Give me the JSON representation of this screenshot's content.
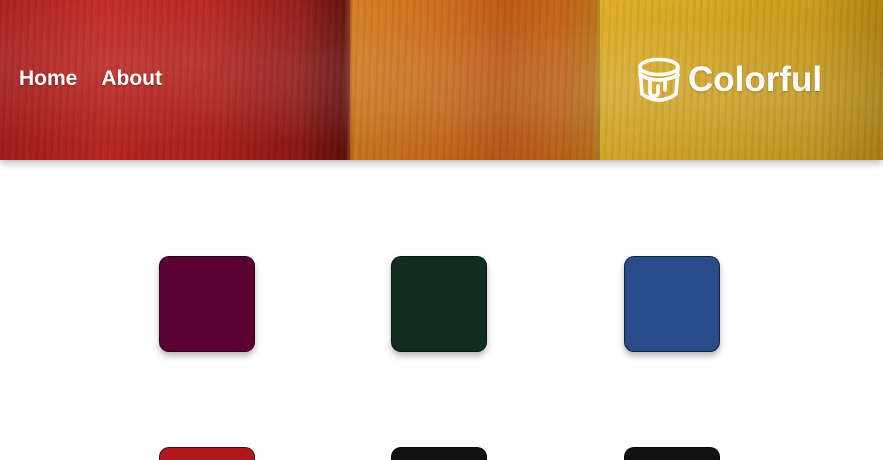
{
  "nav": {
    "home_label": "Home",
    "about_label": "About"
  },
  "brand": {
    "name": "Colorful",
    "icon": "paint-bucket-icon"
  },
  "swatches": [
    {
      "color": "#5c0233"
    },
    {
      "color": "#132c20"
    },
    {
      "color": "#284c89"
    }
  ],
  "next_row_swatches": [
    {
      "color": "#b0171a"
    },
    {
      "color": "#111111"
    },
    {
      "color": "#111111"
    }
  ]
}
